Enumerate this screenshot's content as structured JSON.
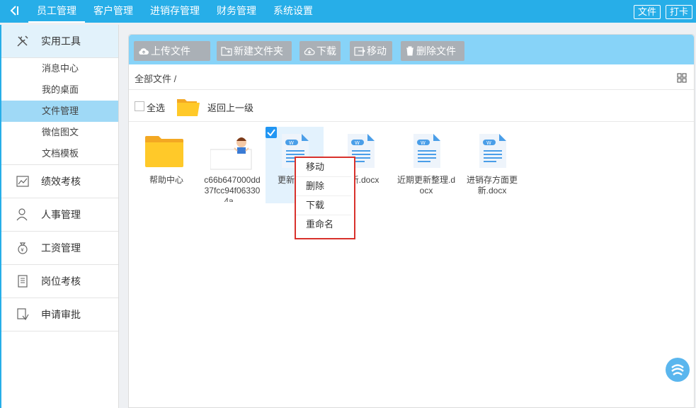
{
  "topbar": {
    "collapse_glyph": "〈|",
    "nav": [
      "员工管理",
      "客户管理",
      "进销存管理",
      "财务管理",
      "系统设置"
    ],
    "file_btn": "文件",
    "clock_btn": "打卡"
  },
  "sidebar": {
    "tools": {
      "label": "实用工具",
      "icon": "tools-icon",
      "items": [
        "消息中心",
        "我的桌面",
        "文件管理",
        "微信图文",
        "文档模板"
      ]
    },
    "groups": [
      {
        "label": "绩效考核",
        "icon": "chart-icon"
      },
      {
        "label": "人事管理",
        "icon": "person-icon"
      },
      {
        "label": "工资管理",
        "icon": "money-bag-icon"
      },
      {
        "label": "岗位考核",
        "icon": "document-list-icon"
      },
      {
        "label": "申请审批",
        "icon": "approval-icon"
      }
    ]
  },
  "toolbar": {
    "upload": "上传文件",
    "new_folder": "新建文件夹",
    "download": "下载",
    "move": "移动",
    "delete": "删除文件"
  },
  "breadcrumb": "全部文件 /",
  "select_all": "全选",
  "back": "返回上一级",
  "files": [
    {
      "name": "帮助中心",
      "type": "folder"
    },
    {
      "name": "c66b647000dd37fcc94f063304a...",
      "type": "image"
    },
    {
      "name": "更新目录",
      "type": "doc",
      "selected": true
    },
    {
      "name": "更新.docx",
      "type": "doc"
    },
    {
      "name": "近期更新整理.docx",
      "type": "doc"
    },
    {
      "name": "进销存方面更新.docx",
      "type": "doc"
    }
  ],
  "context_menu": [
    "移动",
    "删除",
    "下载",
    "重命名"
  ],
  "colors": {
    "topbar": "#27aee8",
    "toolbar": "#87d3f8",
    "active_menu": "#9fd9f6",
    "folder": "#ffc929",
    "doc": "#4a9ee8",
    "highlight_border": "#d8312c"
  }
}
